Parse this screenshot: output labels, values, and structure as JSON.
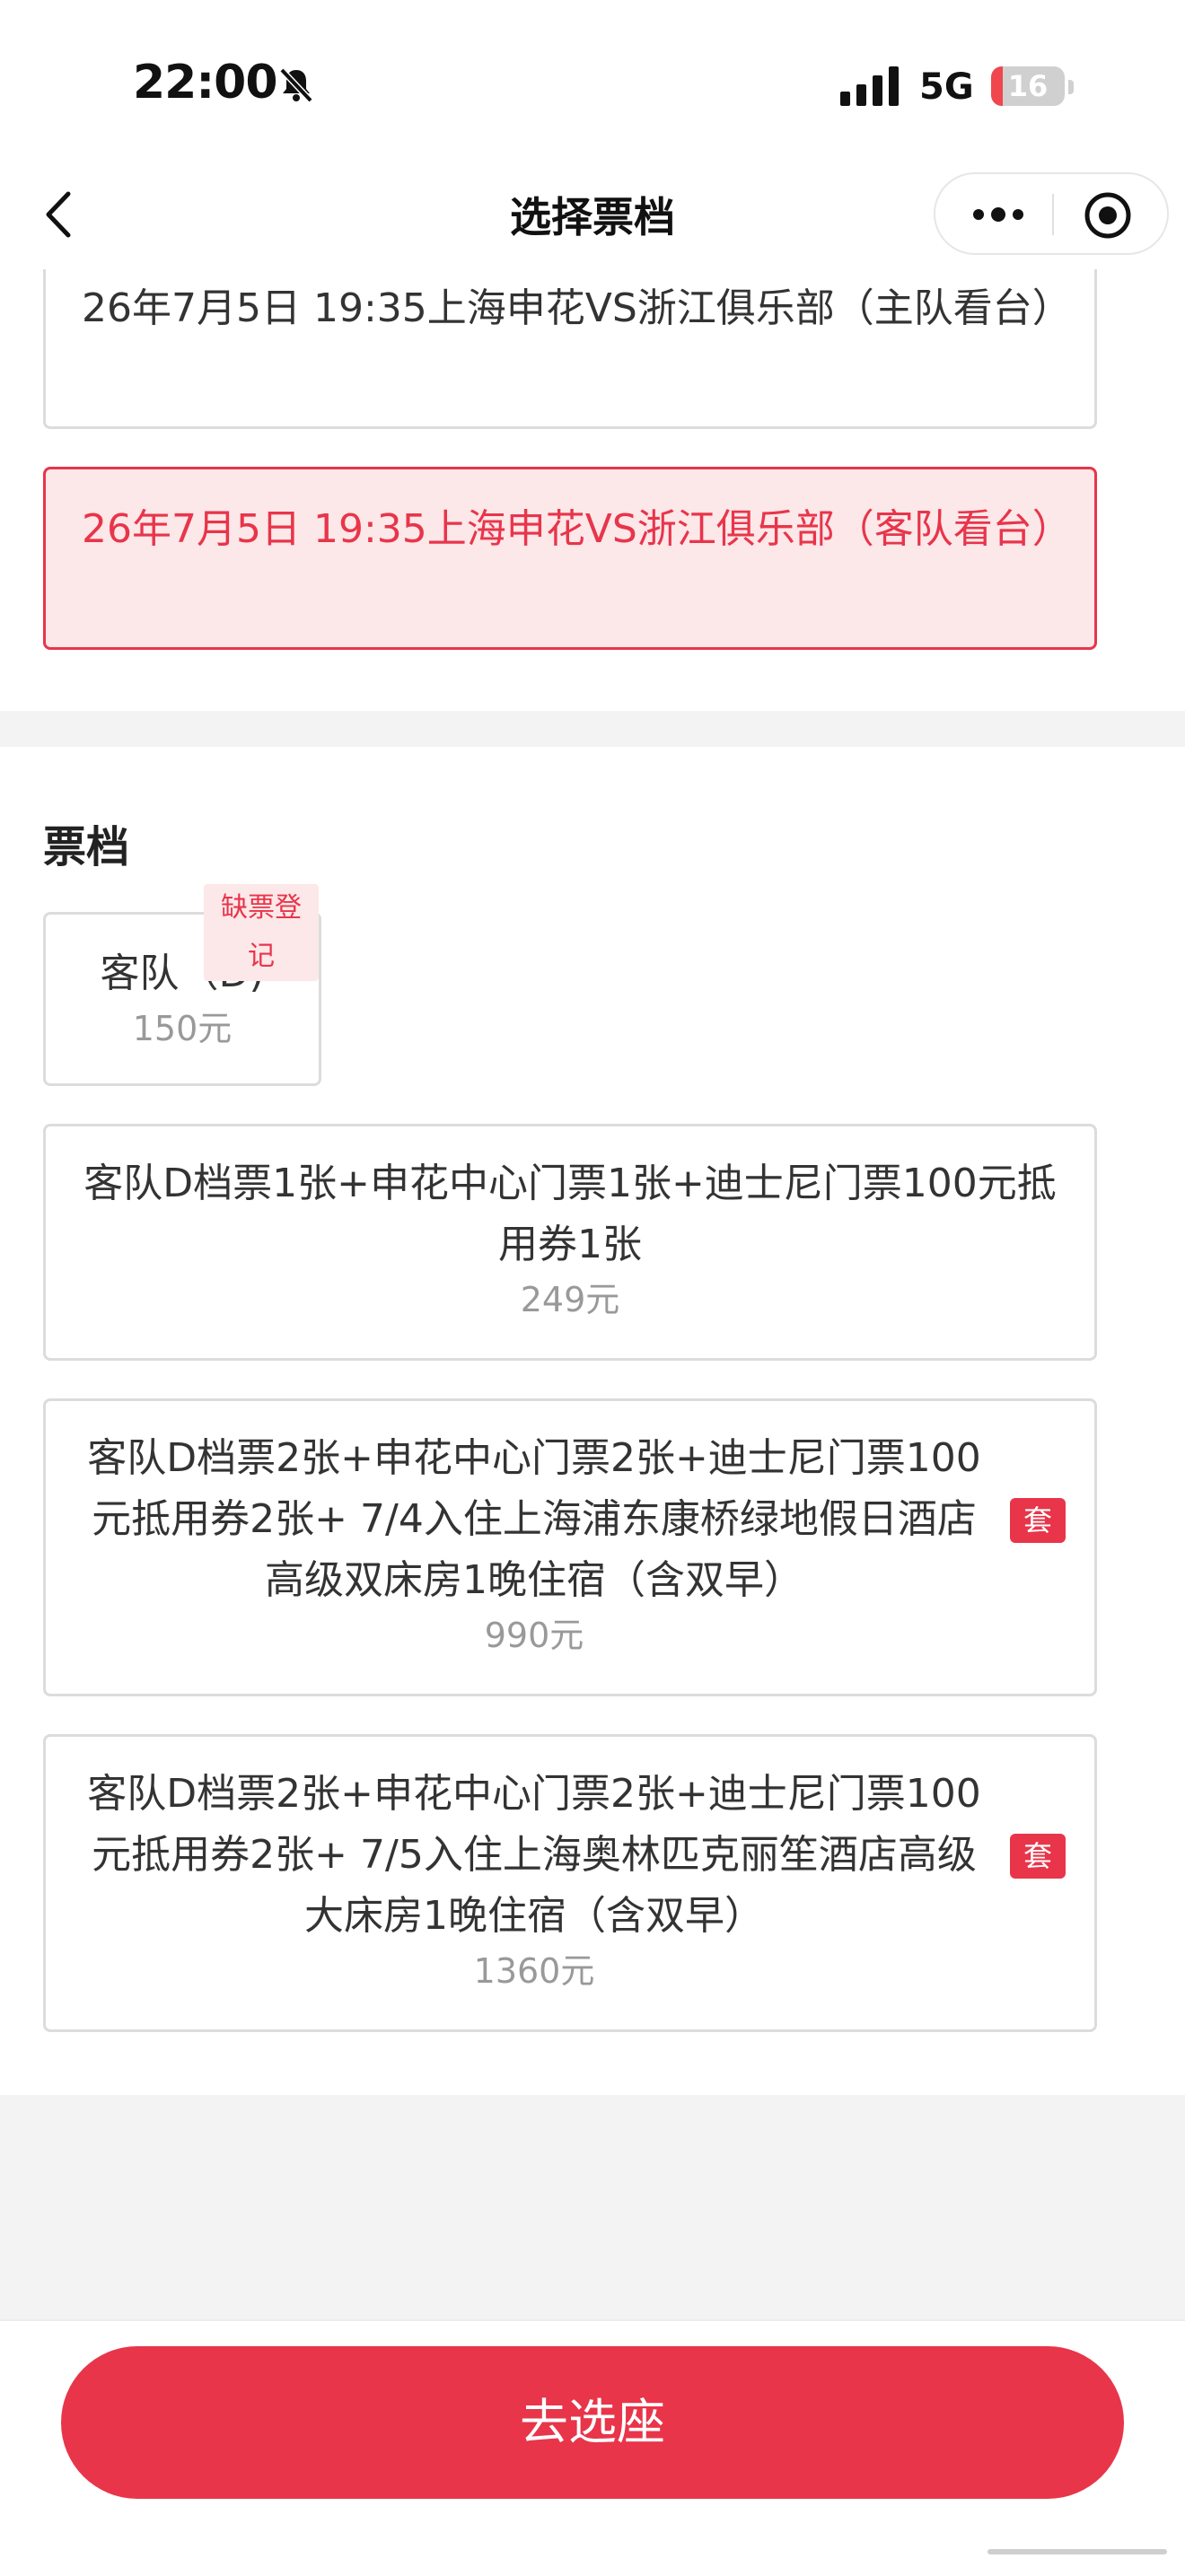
{
  "status_bar": {
    "time": "22:00",
    "network": "5G",
    "battery_level": "16",
    "battery_fraction": 0.16,
    "battery_color": "#f0464d"
  },
  "nav": {
    "title": "选择票档",
    "back_icon": "chevron-left-icon",
    "more_icon": "more-dots-icon",
    "close_icon": "target-circle-icon"
  },
  "matches": [
    {
      "label": "26年7月5日 19:35上海申花VS浙江俱乐部（主队看台）",
      "selected": false
    },
    {
      "label": "26年7月5日 19:35上海申花VS浙江俱乐部（客队看台）",
      "selected": true
    }
  ],
  "tier_section": {
    "title": "票档",
    "tiers": [
      {
        "name": "客队（D)",
        "price": "150元",
        "badge": "缺票登记"
      },
      {
        "name": "客队D档票1张+申花中心门票1张+迪士尼门票100元抵用券1张",
        "price": "249元"
      },
      {
        "name": "客队D档票2张+申花中心门票2张+迪士尼门票100元抵用券2张+ 7/4入住上海浦东康桥绿地假日酒店高级双床房1晚住宿（含双早）",
        "price": "990元",
        "tag": "套"
      },
      {
        "name": "客队D档票2张+申花中心门票2张+迪士尼门票100元抵用券2张+ 7/5入住上海奥林匹克丽笙酒店高级大床房1晚住宿（含双早）",
        "price": "1360元",
        "tag": "套"
      }
    ]
  },
  "bottom": {
    "button_label": "去选座"
  },
  "colors": {
    "accent": "#e8354a",
    "accent_light": "#fce7e9",
    "border": "#dcdcdc",
    "muted": "#999999"
  }
}
